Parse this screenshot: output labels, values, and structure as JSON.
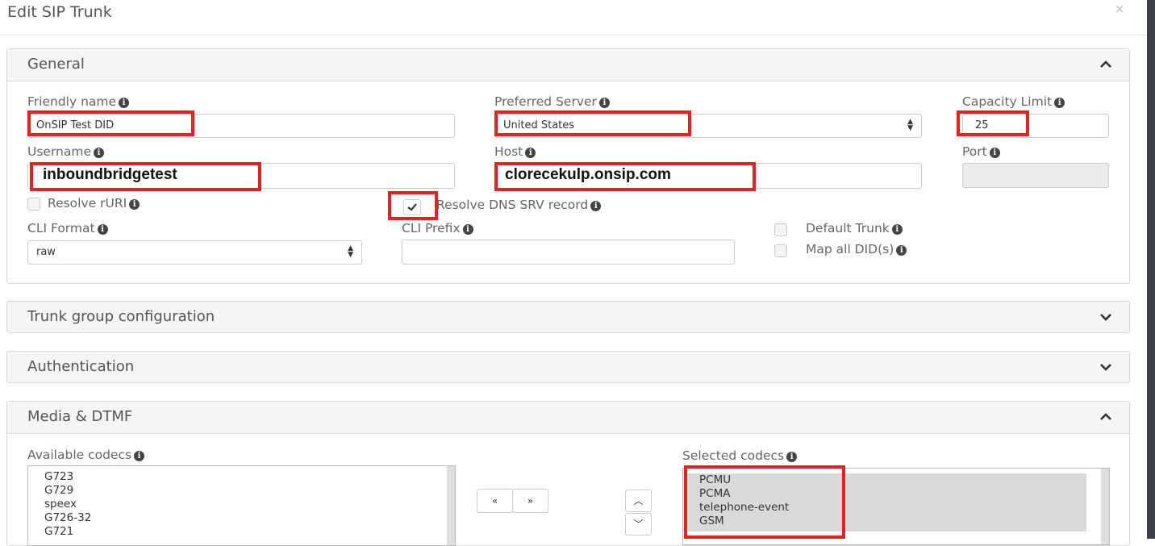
{
  "dialog": {
    "title": "Edit SIP Trunk",
    "close_glyph": "×"
  },
  "general": {
    "title": "General",
    "friendly_name": {
      "label": "Friendly name",
      "value": "OnSIP Test DID"
    },
    "preferred_server": {
      "label": "Preferred Server",
      "value": "United States"
    },
    "capacity_limit": {
      "label": "Capacity Limit",
      "value": "25"
    },
    "username": {
      "label": "Username",
      "value": "inboundbridgetest"
    },
    "host": {
      "label": "Host",
      "value": "clorecekulp.onsip.com"
    },
    "port": {
      "label": "Port",
      "value": ""
    },
    "resolve_ruri": {
      "label": "Resolve rURI",
      "checked": false
    },
    "resolve_dns": {
      "label": "Resolve DNS SRV record",
      "checked": true
    },
    "cli_format": {
      "label": "CLI Format",
      "value": "raw"
    },
    "cli_prefix": {
      "label": "CLI Prefix",
      "value": ""
    },
    "default_trunk": {
      "label": "Default Trunk",
      "checked": false
    },
    "map_all_did": {
      "label": "Map all DID(s)",
      "checked": false
    }
  },
  "trunk_group": {
    "title": "Trunk group configuration"
  },
  "authentication": {
    "title": "Authentication"
  },
  "media": {
    "title": "Media & DTMF",
    "available_label": "Available codecs",
    "available": [
      "G723",
      "G729",
      "speex",
      "G726-32",
      "G721"
    ],
    "selected_label": "Selected codecs",
    "selected": [
      "PCMU",
      "PCMA",
      "telephone-event",
      "GSM"
    ],
    "move_left": "«",
    "move_right": "»",
    "move_up": "︿",
    "move_down": "﹀"
  },
  "icons": {
    "info": "info-icon",
    "expanded": "chevron-up-icon",
    "collapsed": "chevron-down-icon"
  },
  "colors": {
    "highlight": "#ee1e1e",
    "panel_header": "#f5f5f5"
  }
}
